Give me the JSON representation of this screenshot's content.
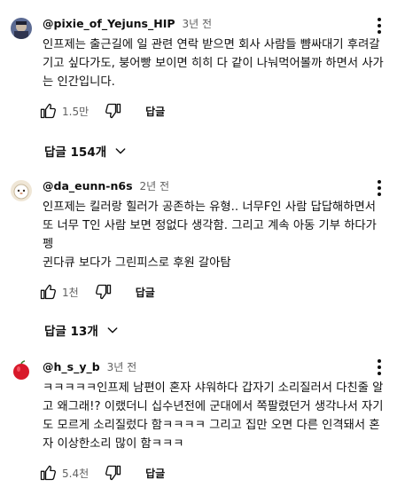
{
  "comments": [
    {
      "handle": "@pixie_of_Yejuns_HIP",
      "time": "3년 전",
      "text": "인프제는 출근길에 일 관련 연락 받으면 회사 사람들 뺨싸대기 후려갈\n기고 싶다가도, 붕어빵 보이면 히히 다 같이 나눠먹어볼까 하면서 사가\n는 인간입니다.",
      "likes": "1.5만",
      "reply_label": "답글",
      "replies_label": "답글 154개",
      "avatar_color": "#8a93b8"
    },
    {
      "handle": "@da_eunn-n6s",
      "time": "2년 전",
      "text": "인프제는 킬러랑 힐러가 공존하는 유형.. 너무F인 사람 답답해하면서\n또 너무 T인 사람 보면 정없다 생각함. 그리고 계속 아동 기부 하다가 펭\n귄다큐 보다가 그린피스로 후원 갈아탐",
      "likes": "1천",
      "reply_label": "답글",
      "replies_label": "답글 13개",
      "avatar_color": "#e7dcc8"
    },
    {
      "handle": "@h_s_y_b",
      "time": "3년 전",
      "text": "ㅋㅋㅋㅋㅋ인프제 남편이 혼자 샤워하다 갑자기 소리질러서 다친줄 알\n고 왜그래!? 이랬더니 십수년전에 군대에서 쪽팔렸던거 생각나서 자기\n도 모르게 소리질렀다 함ㅋㅋㅋㅋ 그리고 집만 오면 다른 인격돼서 혼\n자 이상한소리 많이 함ㅋㅋㅋ",
      "likes": "5.4천",
      "reply_label": "답글",
      "avatar_color": "#d8192a"
    }
  ]
}
